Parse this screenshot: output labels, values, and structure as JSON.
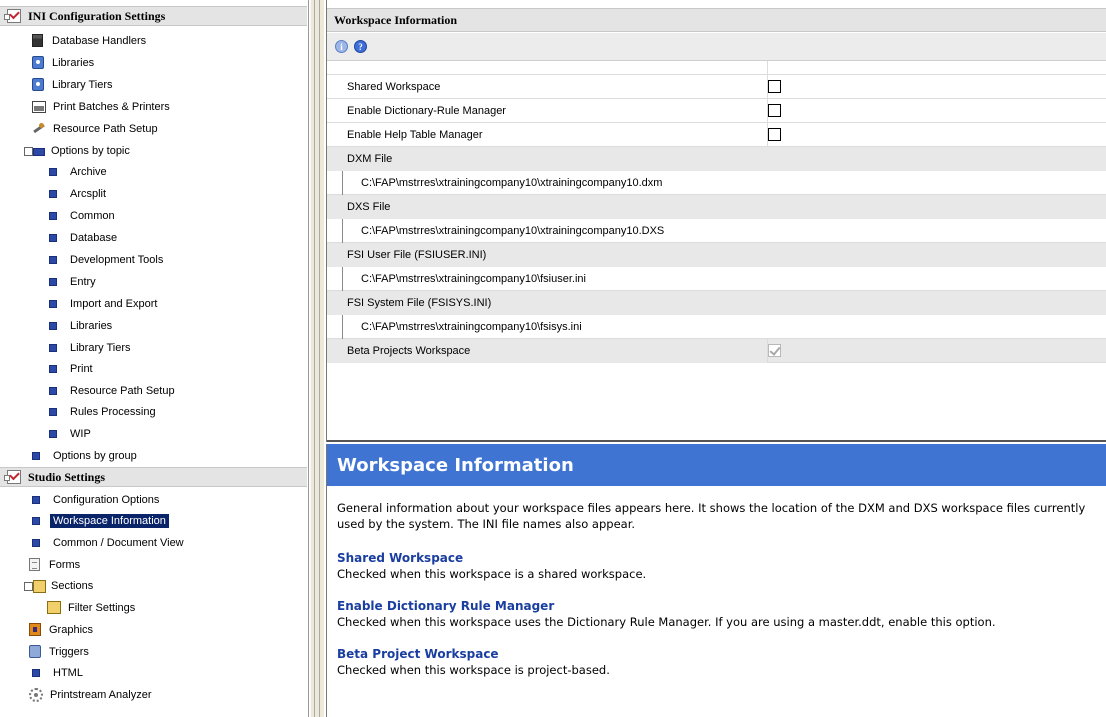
{
  "tree": {
    "ini_header": "INI Configuration Settings",
    "ini_items": [
      "Database Handlers",
      "Libraries",
      "Library Tiers",
      "Print Batches & Printers",
      "Resource Path Setup",
      "Options by topic"
    ],
    "topic_items": [
      "Archive",
      "Arcsplit",
      "Common",
      "Database",
      "Development Tools",
      "Entry",
      "Import and Export",
      "Libraries",
      "Library Tiers",
      "Print",
      "Resource Path Setup",
      "Rules Processing",
      "WIP"
    ],
    "options_by_group": "Options by group",
    "studio_header": "Studio Settings",
    "studio_items": [
      "Configuration Options",
      "Workspace Information",
      "Common / Document View",
      "Forms",
      "Sections",
      "Filter Settings",
      "Graphics",
      "Triggers",
      "HTML",
      "Printstream Analyzer"
    ],
    "selected": "Workspace Information"
  },
  "props": {
    "title": "Workspace Information",
    "rows": {
      "shared_workspace": "Shared Workspace",
      "enable_dict_rule_mgr": "Enable Dictionary-Rule Manager",
      "enable_help_table_mgr": "Enable Help Table Manager",
      "dxm_file": "DXM File",
      "dxm_path": "C:\\FAP\\mstrres\\xtrainingcompany10\\xtrainingcompany10.dxm",
      "dxs_file": "DXS File",
      "dxs_path": "C:\\FAP\\mstrres\\xtrainingcompany10\\xtrainingcompany10.DXS",
      "fsi_user_file": "FSI User File (FSIUSER.INI)",
      "fsi_user_path": "C:\\FAP\\mstrres\\xtrainingcompany10\\fsiuser.ini",
      "fsi_system_file": "FSI System File (FSISYS.INI)",
      "fsi_system_path": "C:\\FAP\\mstrres\\xtrainingcompany10\\fsisys.ini",
      "beta_projects": "Beta Projects Workspace"
    },
    "values": {
      "shared_workspace": false,
      "enable_dict_rule_mgr": false,
      "enable_help_table_mgr": false,
      "beta_projects": true
    }
  },
  "help": {
    "title": "Workspace Information",
    "intro": "General information about your workspace files appears here. It shows the location of the DXM and DXS workspace files currently used by the system. The INI file names also appear.",
    "sections": [
      {
        "heading": "Shared Workspace",
        "text": "Checked when this workspace is a shared workspace."
      },
      {
        "heading": "Enable Dictionary Rule Manager",
        "text": "Checked when this workspace uses the Dictionary Rule Manager. If you are using a master.ddt, enable this option."
      },
      {
        "heading": "Beta Project Workspace",
        "text": "Checked when this workspace is project-based."
      }
    ]
  },
  "colors": {
    "selection": "#0a246a",
    "help_banner": "#3f74d3",
    "help_heading": "#1a3ea0"
  }
}
